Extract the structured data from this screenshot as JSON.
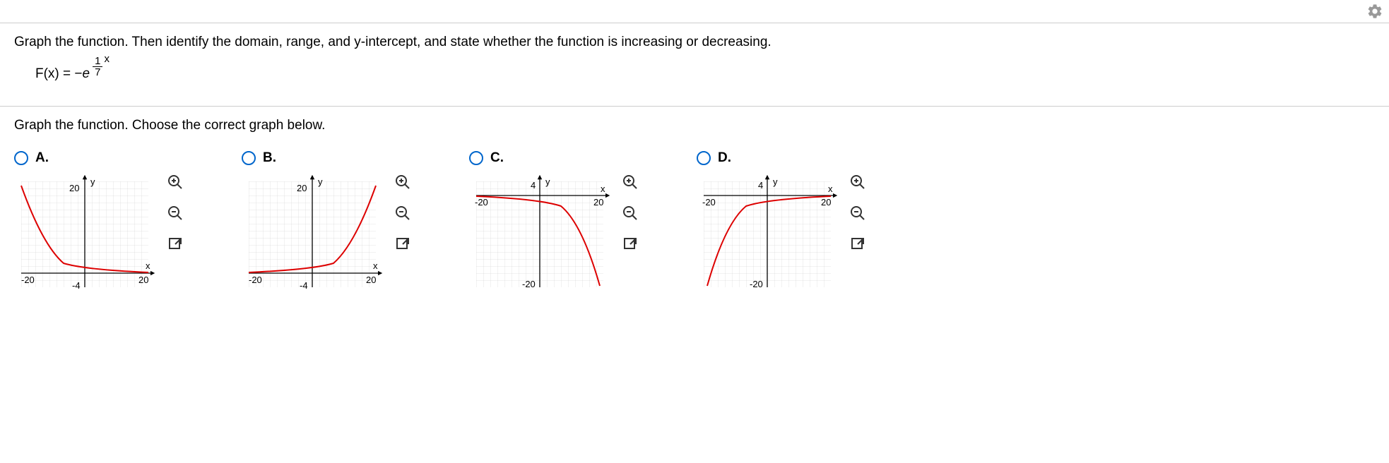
{
  "question": "Graph the function. Then identify the domain, range, and y-intercept, and state whether the function is increasing or decreasing.",
  "formula": {
    "lhs": "F(x) = − ",
    "base": "e",
    "frac_num": "1",
    "frac_den": "7",
    "exp_var": "x"
  },
  "sub_question": "Graph the function. Choose the correct graph below.",
  "options": {
    "a_label": "A.",
    "b_label": "B.",
    "c_label": "C.",
    "d_label": "D."
  },
  "axis": {
    "y_label": "y",
    "x_label": "x",
    "neg20": "-20",
    "pos20": "20",
    "neg4": "-4",
    "pos4": "4"
  },
  "icons": {
    "gear": "gear-icon",
    "zoom_in": "zoom-in-icon",
    "zoom_out": "zoom-out-icon",
    "popout": "popout-icon"
  },
  "chart_data": [
    {
      "type": "line",
      "option": "A",
      "title": "",
      "xlabel": "x",
      "ylabel": "y",
      "xlim": [
        -20,
        20
      ],
      "ylim": [
        -4,
        20
      ],
      "description": "e^{-x/7} decreasing curve, positive y",
      "x": [
        -20,
        -15,
        -10,
        -5,
        0,
        5,
        10,
        15,
        20
      ],
      "values": [
        17.4,
        8.5,
        4.2,
        2.0,
        1.0,
        0.49,
        0.24,
        0.12,
        0.06
      ]
    },
    {
      "type": "line",
      "option": "B",
      "title": "",
      "xlabel": "x",
      "ylabel": "y",
      "xlim": [
        -20,
        20
      ],
      "ylim": [
        -4,
        20
      ],
      "description": "e^{x/7} increasing curve, positive y",
      "x": [
        -20,
        -15,
        -10,
        -5,
        0,
        5,
        10,
        15,
        20
      ],
      "values": [
        0.06,
        0.12,
        0.24,
        0.49,
        1.0,
        2.0,
        4.2,
        8.5,
        17.4
      ]
    },
    {
      "type": "line",
      "option": "C",
      "title": "",
      "xlabel": "x",
      "ylabel": "y",
      "xlim": [
        -20,
        20
      ],
      "ylim": [
        -20,
        4
      ],
      "description": "-e^{x/7} decreasing curve, negative y",
      "x": [
        -20,
        -15,
        -10,
        -5,
        0,
        5,
        10,
        15,
        20
      ],
      "values": [
        -0.06,
        -0.12,
        -0.24,
        -0.49,
        -1.0,
        -2.0,
        -4.2,
        -8.5,
        -17.4
      ]
    },
    {
      "type": "line",
      "option": "D",
      "title": "",
      "xlabel": "x",
      "ylabel": "y",
      "xlim": [
        -20,
        20
      ],
      "ylim": [
        -20,
        4
      ],
      "description": "-e^{-x/7} increasing curve, negative y",
      "x": [
        -20,
        -15,
        -10,
        -5,
        0,
        5,
        10,
        15,
        20
      ],
      "values": [
        -17.4,
        -8.5,
        -4.2,
        -2.0,
        -1.0,
        -0.49,
        -0.24,
        -0.12,
        -0.06
      ]
    }
  ]
}
